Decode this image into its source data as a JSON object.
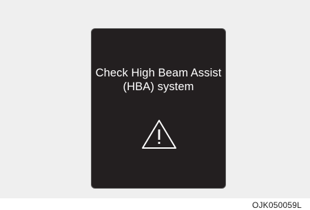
{
  "display": {
    "line1": "Check High Beam Assist",
    "line2": "(HBA) system",
    "icon": "warning-triangle-icon"
  },
  "figure_code": "OJK050059L",
  "colors": {
    "display_bg": "#231f20",
    "frame_bg": "#efefef",
    "text": "#ffffff"
  }
}
